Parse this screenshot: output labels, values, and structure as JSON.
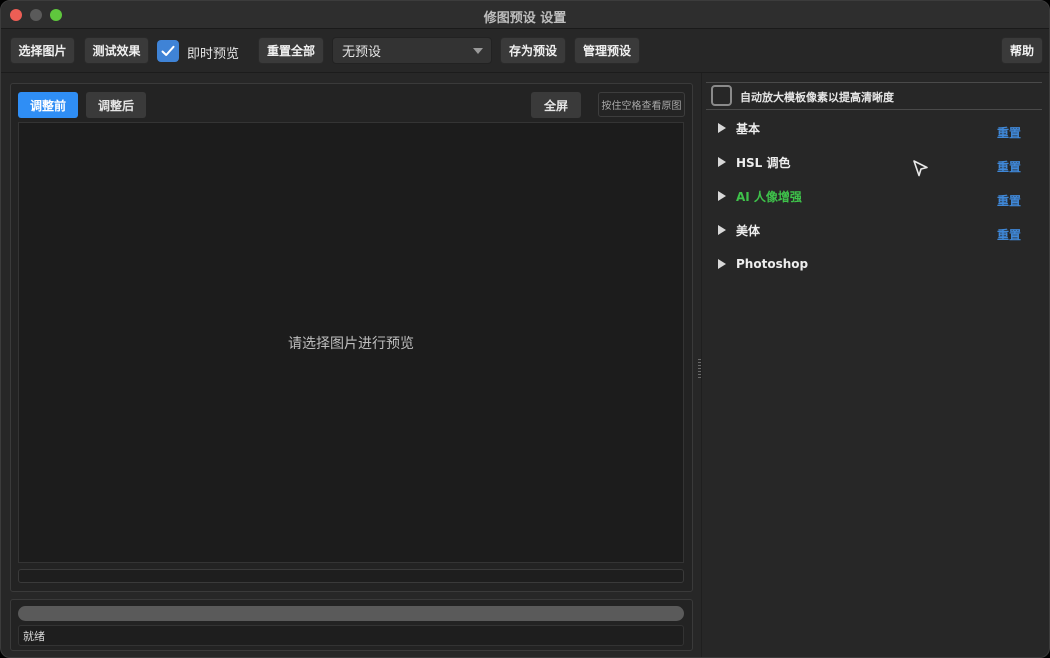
{
  "window": {
    "title": "修图预设 设置"
  },
  "toolbar": {
    "select_image": "选择图片",
    "test_effect": "测试效果",
    "live_preview_label": "即时预览",
    "live_preview_checked": true,
    "reset_all": "重置全部",
    "preset_value": "无预设",
    "save_preset": "存为预设",
    "manage_preset": "管理预设",
    "help": "帮助"
  },
  "preview": {
    "tab_before": "调整前",
    "tab_after": "调整后",
    "fullscreen": "全屏",
    "space_hint": "按住空格查看原图",
    "placeholder": "请选择图片进行预览"
  },
  "status": {
    "text": "就绪"
  },
  "right_panel": {
    "auto_upscale_label": "自动放大模板像素以提高清晰度",
    "auto_upscale_checked": false,
    "reset_label": "重置",
    "sections": [
      {
        "label": "基本",
        "has_reset": true,
        "highlight": false
      },
      {
        "label": "HSL 调色",
        "has_reset": true,
        "highlight": false
      },
      {
        "label": "AI 人像增强",
        "has_reset": true,
        "highlight": true
      },
      {
        "label": "美体",
        "has_reset": true,
        "highlight": false
      },
      {
        "label": "Photoshop",
        "has_reset": false,
        "highlight": false
      }
    ]
  },
  "colors": {
    "accent_blue": "#2f8ef5",
    "reset_link": "#3f88d8",
    "highlight_green": "#3ec24a"
  }
}
